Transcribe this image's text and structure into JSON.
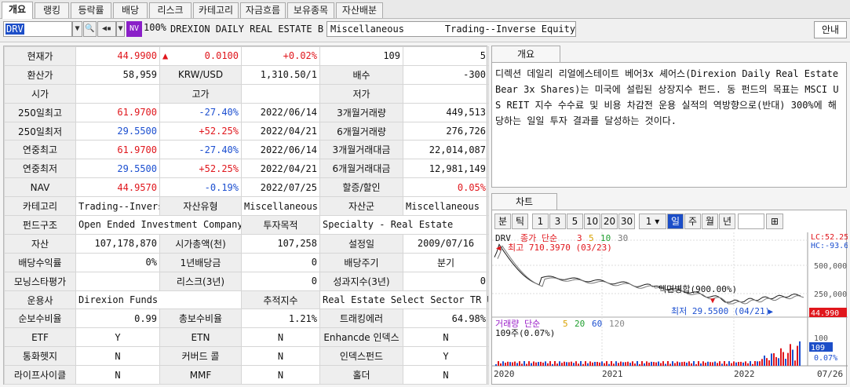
{
  "tabs": [
    "개요",
    "랭킹",
    "등락률",
    "배당",
    "리스크",
    "카테고리",
    "자금흐름",
    "보유종목",
    "자산배분"
  ],
  "toolbar": {
    "symbol": "DRV",
    "nv_badge": "NV",
    "percent": "100%",
    "fund_name": "DREXION DAILY REAL ESTATE BE",
    "category_left": "Miscellaneous",
    "category_right": "Trading--Inverse Equity",
    "guide_button": "안내"
  },
  "info": {
    "r1": [
      "현재가",
      "44.9900",
      "▲",
      "0.0100",
      "+0.02%",
      "109",
      "5"
    ],
    "r2": [
      "환산가",
      "58,959",
      "KRW/USD",
      "1,310.50/1",
      "배수",
      "-300"
    ],
    "r3": [
      "시가",
      "",
      "고가",
      "",
      "저가",
      ""
    ],
    "r4": [
      "250일최고",
      "61.9700",
      "-27.40%",
      "2022/06/14",
      "3개월거래량",
      "449,513"
    ],
    "r5": [
      "250일최저",
      "29.5500",
      "+52.25%",
      "2022/04/21",
      "6개월거래량",
      "276,726"
    ],
    "r6": [
      "연중최고",
      "61.9700",
      "-27.40%",
      "2022/06/14",
      "3개월거래대금",
      "22,014,087"
    ],
    "r7": [
      "연중최저",
      "29.5500",
      "+52.25%",
      "2022/04/21",
      "6개월거래대금",
      "12,981,149"
    ],
    "r8": [
      "NAV",
      "44.9570",
      "-0.19%",
      "2022/07/25",
      "할증/할인",
      "0.05%"
    ],
    "r9": [
      "카테고리",
      "Trading--Invers",
      "자산유형",
      "Miscellaneous",
      "자산군",
      "Miscellaneous"
    ],
    "r10": [
      "펀드구조",
      "Open Ended Investment Company",
      "투자목적",
      "Specialty - Real Estate"
    ],
    "r11": [
      "자산",
      "107,178,870",
      "시가총액(천)",
      "107,258",
      "설정일",
      "2009/07/16"
    ],
    "r12": [
      "배당수익률",
      "0%",
      "1년배당금",
      "0",
      "배당주기",
      "분기"
    ],
    "r13": [
      "모닝스타평가",
      "",
      "리스크(3년)",
      "0",
      "성과지수(3년)",
      "0"
    ],
    "r14": [
      "운용사",
      "Direxion Funds",
      "추적지수",
      "Real Estate Select Sector TR U"
    ],
    "r15": [
      "순보수비율",
      "0.99",
      "총보수비율",
      "1.21%",
      "트래킹에러",
      "64.98%"
    ],
    "r16": [
      "ETF",
      "Y",
      "ETN",
      "N",
      "Enhancde 인덱스",
      "N"
    ],
    "r17": [
      "통화헷지",
      "N",
      "커버드 콜",
      "N",
      "인덱스펀드",
      "Y"
    ],
    "r18": [
      "라이프사이클",
      "N",
      "MMF",
      "N",
      "홀더",
      "N"
    ]
  },
  "overview": {
    "tab": "개요",
    "text": "디렉션 데일리 리얼에스테이트 베어3x 셰어스(Direxion Daily Real Estate Bear 3x Shares)는 미국에 설립된 상장지수 펀드. 동 펀드의 목표는 MSCI US REIT 지수 수수료 및 비용 차감전 운용 실적의 역방향으로(반대) 300%에 해당하는 일일 투자 결과를 달성하는 것이다."
  },
  "chart": {
    "tab": "차트",
    "periods": [
      "분",
      "틱",
      "1",
      "3",
      "5",
      "10",
      "20",
      "30",
      "1",
      "일",
      "주",
      "월",
      "년"
    ],
    "selected": "일",
    "price_legend": {
      "sym": "DRV",
      "label": "종가 단순",
      "ma": [
        "3",
        "5",
        "10",
        "30"
      ]
    },
    "high_label": "최고 710.3970 (03/23)",
    "low_label": "최저 29.5500 (04/21)",
    "split_label": "액면병합(900.00%)",
    "lc": "LC:52.25",
    "hc": "HC:-93.6",
    "price_ticks": [
      "500,000",
      "250,000"
    ],
    "current_price": "44.990",
    "vol_legend": {
      "label": "거래량 단순",
      "ma": [
        "5",
        "20",
        "60",
        "120"
      ]
    },
    "vol_sub": "109주(0.07%)",
    "vol_ticks": [
      "100",
      "109",
      "0.07%"
    ],
    "x_ticks": [
      "2020",
      "2021",
      "2022",
      "07/26"
    ],
    "colors": {
      "ma3": "#e0161c",
      "ma5": "#d9a100",
      "ma10": "#1f9e2e",
      "ma30": "#777777",
      "price": "#1a1a1a"
    }
  },
  "chart_data": {
    "type": "line",
    "title": "",
    "x": [
      "2020",
      "2021",
      "2022",
      "07/26"
    ],
    "series": [
      {
        "name": "DRV",
        "values": [
          710.397,
          29.55,
          44.99
        ]
      }
    ],
    "annotations": [
      "최고 710.3970 (03/23)",
      "최저 29.5500 (04/21)",
      "액면병합(900.00%)"
    ]
  }
}
